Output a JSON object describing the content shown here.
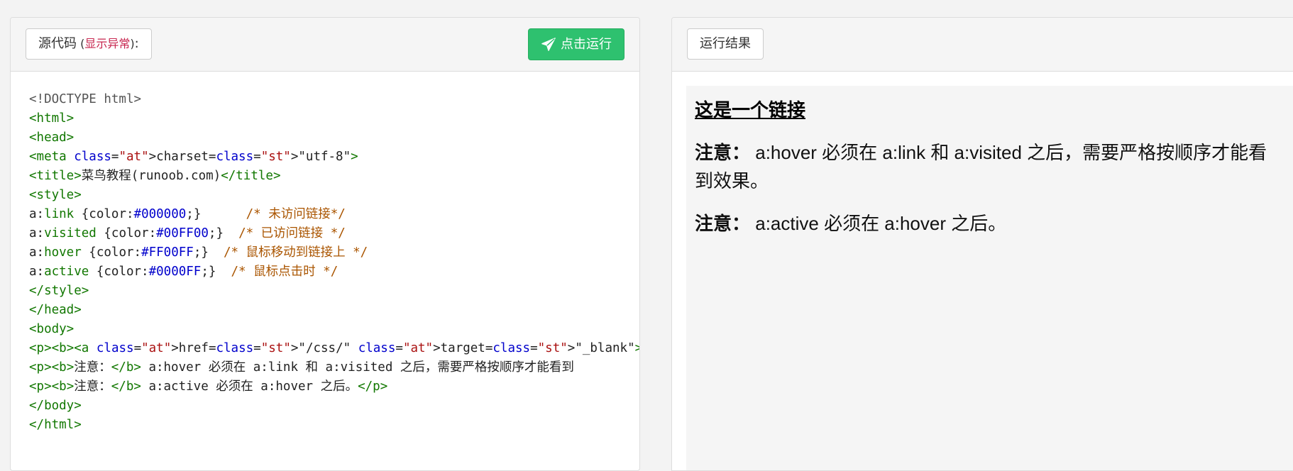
{
  "source": {
    "label": "源代码",
    "anomaly_open": " (",
    "anomaly_link": "显示异常",
    "anomaly_close": ")",
    "colon": ":"
  },
  "run_button": {
    "label": "点击运行",
    "icon": "send-icon",
    "color": "#2ec16f"
  },
  "code_lines": [
    "<!DOCTYPE html>",
    "<html>",
    "<head>",
    "<meta charset=\"utf-8\">",
    "<title>菜鸟教程(runoob.com)</title>",
    "<style>",
    "a:link {color:#000000;}      /* 未访问链接*/",
    "a:visited {color:#00FF00;}  /* 已访问链接 */",
    "a:hover {color:#FF00FF;}  /* 鼠标移动到链接上 */",
    "a:active {color:#0000FF;}  /* 鼠标点击时 */",
    "</style>",
    "</head>",
    "<body>",
    "<p><b><a href=\"/css/\" target=\"_blank\">这是一个链接</a></b></p>",
    "<p><b>注意：</b> a:hover 必须在 a:link 和 a:visited 之后，需要严格按顺序才能看到",
    "<p><b>注意：</b> a:active 必须在 a:hover 之后。</p>",
    "</body>",
    "</html>"
  ],
  "result": {
    "label": "运行结果",
    "link_text": "这是一个链接",
    "note1_label": "注意：",
    "note1_text": " a:hover 必须在 a:link 和 a:visited 之后，需要严格按顺序才能看到效果。",
    "note2_label": "注意：",
    "note2_text": " a:active 必须在 a:hover 之后。"
  }
}
